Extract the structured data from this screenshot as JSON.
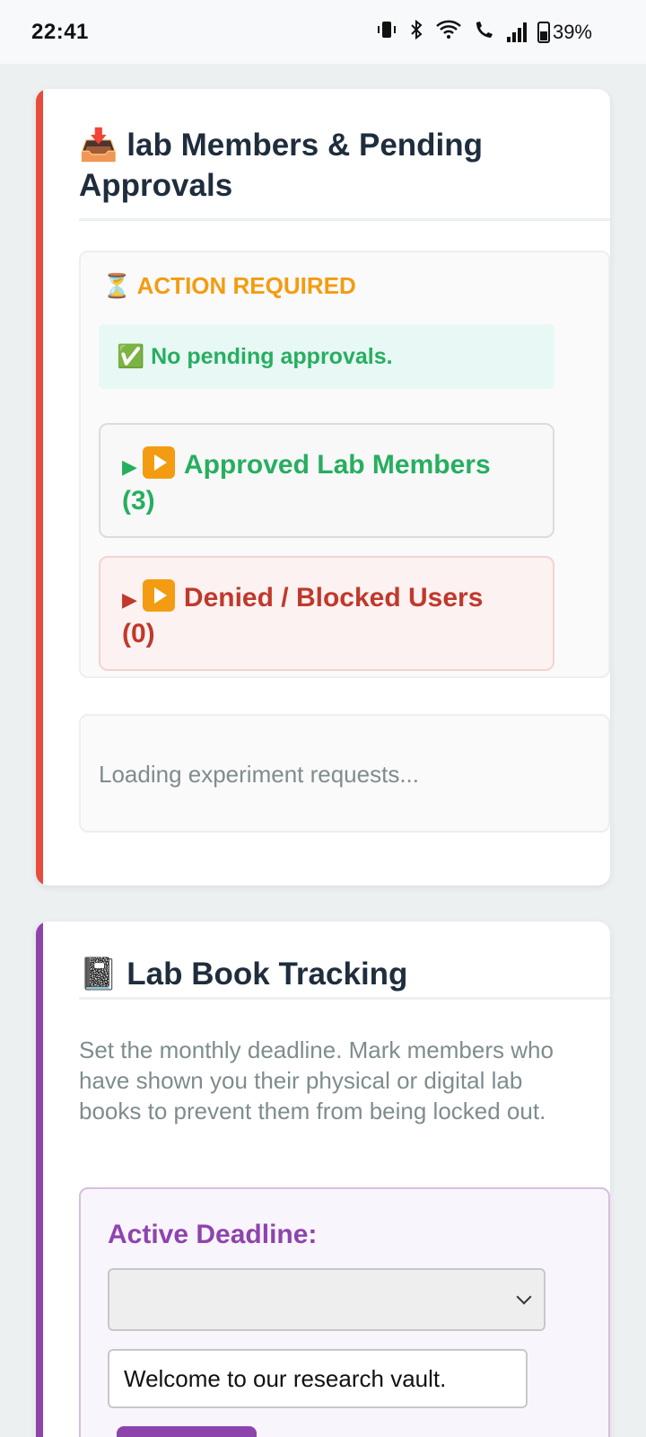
{
  "status_bar": {
    "time": "22:41",
    "battery": "39%"
  },
  "members_card": {
    "title": "📥 lab Members & Pending Approvals",
    "action_required": "⏳ ACTION REQUIRED",
    "no_pending": "✅ No pending approvals.",
    "approved_label": "Approved Lab Members",
    "approved_count": "(3)",
    "denied_label": "Denied / Blocked Users",
    "denied_count": "(0)",
    "loading_text": "Loading experiment requests..."
  },
  "lab_book_card": {
    "title": "📓 Lab Book Tracking",
    "description": "Set the monthly deadline. Mark members who have shown you their physical or digital lab books to prevent them from being locked out.",
    "deadline_label": "Active Deadline:",
    "deadline_value": "",
    "message_value": "Welcome to our research vault."
  },
  "colors": {
    "accent_red": "#e74c3c",
    "accent_purple": "#8e44ad",
    "approved_green": "#27ae60",
    "denied_red": "#c0392b",
    "warning_orange": "#f39c12"
  },
  "icons": [
    "vibrate-icon",
    "bluetooth-icon",
    "wifi-icon",
    "wifi-calling-icon",
    "signal-icon",
    "battery-icon",
    "inbox-tray-icon",
    "hourglass-icon",
    "check-mark-icon",
    "play-button-icon",
    "notebook-icon",
    "chevron-down-icon"
  ]
}
